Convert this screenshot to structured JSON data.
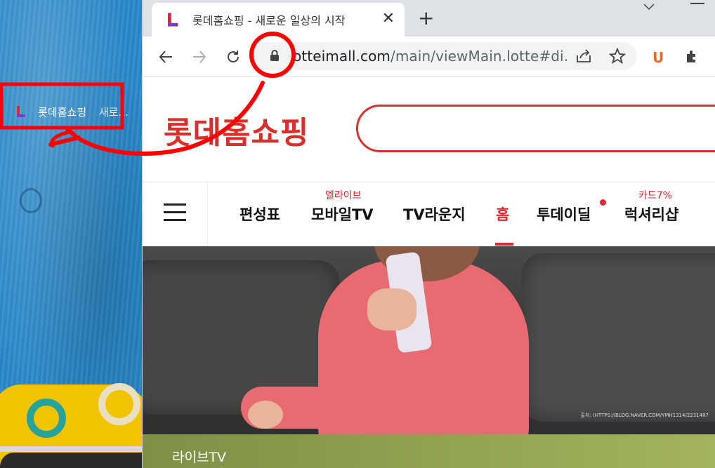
{
  "desktop": {
    "shortcut_label": "롯데홈쇼핑",
    "shortcut_sub": "새로..."
  },
  "browser": {
    "tab": {
      "title": "롯데홈쇼핑 - 새로운 일상의 시작",
      "close": "✕"
    },
    "new_tab": "+",
    "url_visible": "otteimall.com",
    "url_path": "/main/viewMain.lotte#di...",
    "extension_u": "U"
  },
  "page": {
    "logo": "롯데홈쇼핑",
    "nav": {
      "items": [
        {
          "label": "편성표",
          "sub": ""
        },
        {
          "label": "모바일TV",
          "sub": "엘라이브"
        },
        {
          "label": "TV라운지",
          "sub": ""
        },
        {
          "label": "홈",
          "sub": ""
        },
        {
          "label": "투데이딜",
          "sub": ""
        },
        {
          "label": "럭셔리샵",
          "sub": "카드7%"
        }
      ],
      "active_index": 3
    },
    "banner_credit": "출처: (HTTPS://BLOG.NAVER.COM/YMH1314/2231487",
    "live_label": "라이브TV"
  },
  "annotation_color": "#ff0000"
}
